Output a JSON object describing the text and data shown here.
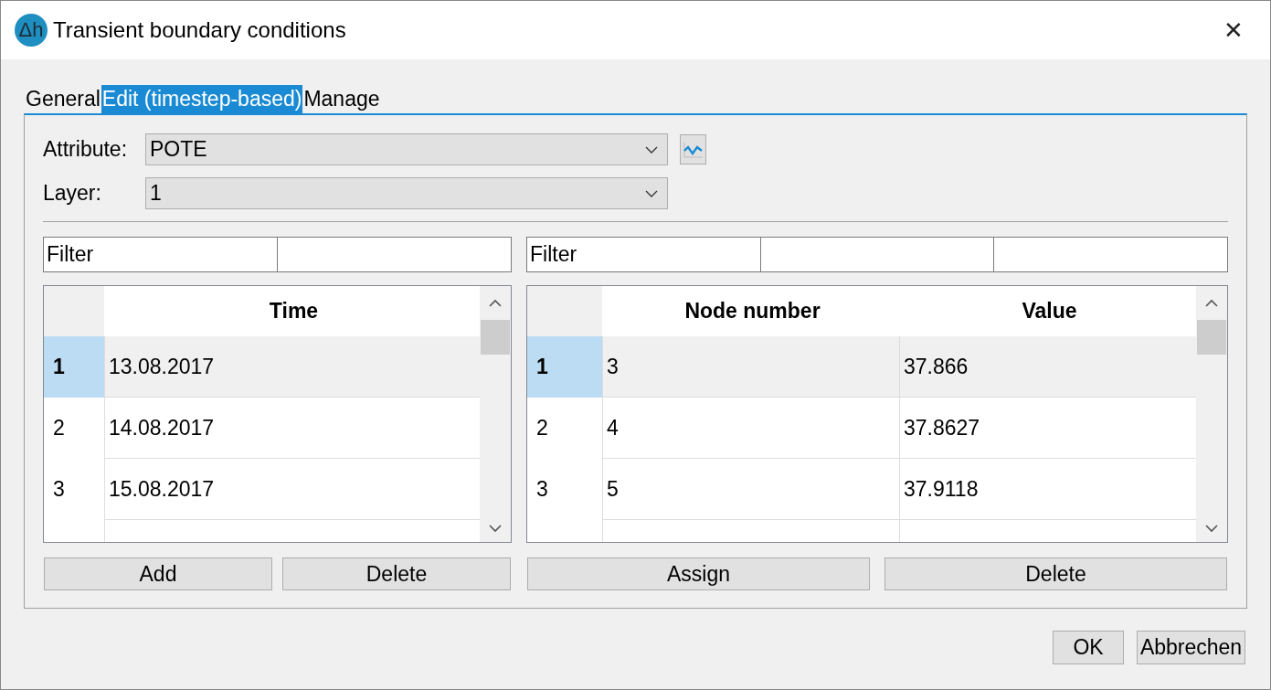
{
  "window": {
    "app_logo": "Δh",
    "title": "Transient boundary conditions",
    "close": "✕"
  },
  "tabs": [
    {
      "label": "General",
      "selected": false
    },
    {
      "label": "Edit (timestep-based)",
      "selected": true
    },
    {
      "label": "Manage",
      "selected": false
    }
  ],
  "attribute": {
    "label": "Attribute:",
    "value": "POTE"
  },
  "layer": {
    "label": "Layer:",
    "value": "1"
  },
  "left": {
    "filter": {
      "placeholder": "Filter"
    },
    "columns": [
      "Time"
    ],
    "rows": [
      {
        "number": "1",
        "selected": true,
        "cells": [
          "13.08.2017"
        ]
      },
      {
        "number": "2",
        "selected": false,
        "cells": [
          "14.08.2017"
        ]
      },
      {
        "number": "3",
        "selected": false,
        "cells": [
          "15.08.2017"
        ]
      }
    ],
    "buttons": [
      "Add",
      "Delete"
    ]
  },
  "right": {
    "filter": {
      "placeholder": "Filter"
    },
    "columns": [
      "Node number",
      "Value"
    ],
    "rows": [
      {
        "number": "1",
        "selected": true,
        "cells": [
          "3",
          "37.866"
        ]
      },
      {
        "number": "2",
        "selected": false,
        "cells": [
          "4",
          "37.8627"
        ]
      },
      {
        "number": "3",
        "selected": false,
        "cells": [
          "5",
          "37.9118"
        ]
      }
    ],
    "buttons": [
      "Assign",
      "Delete"
    ]
  },
  "footer_buttons": [
    "OK",
    "Abbrechen"
  ]
}
